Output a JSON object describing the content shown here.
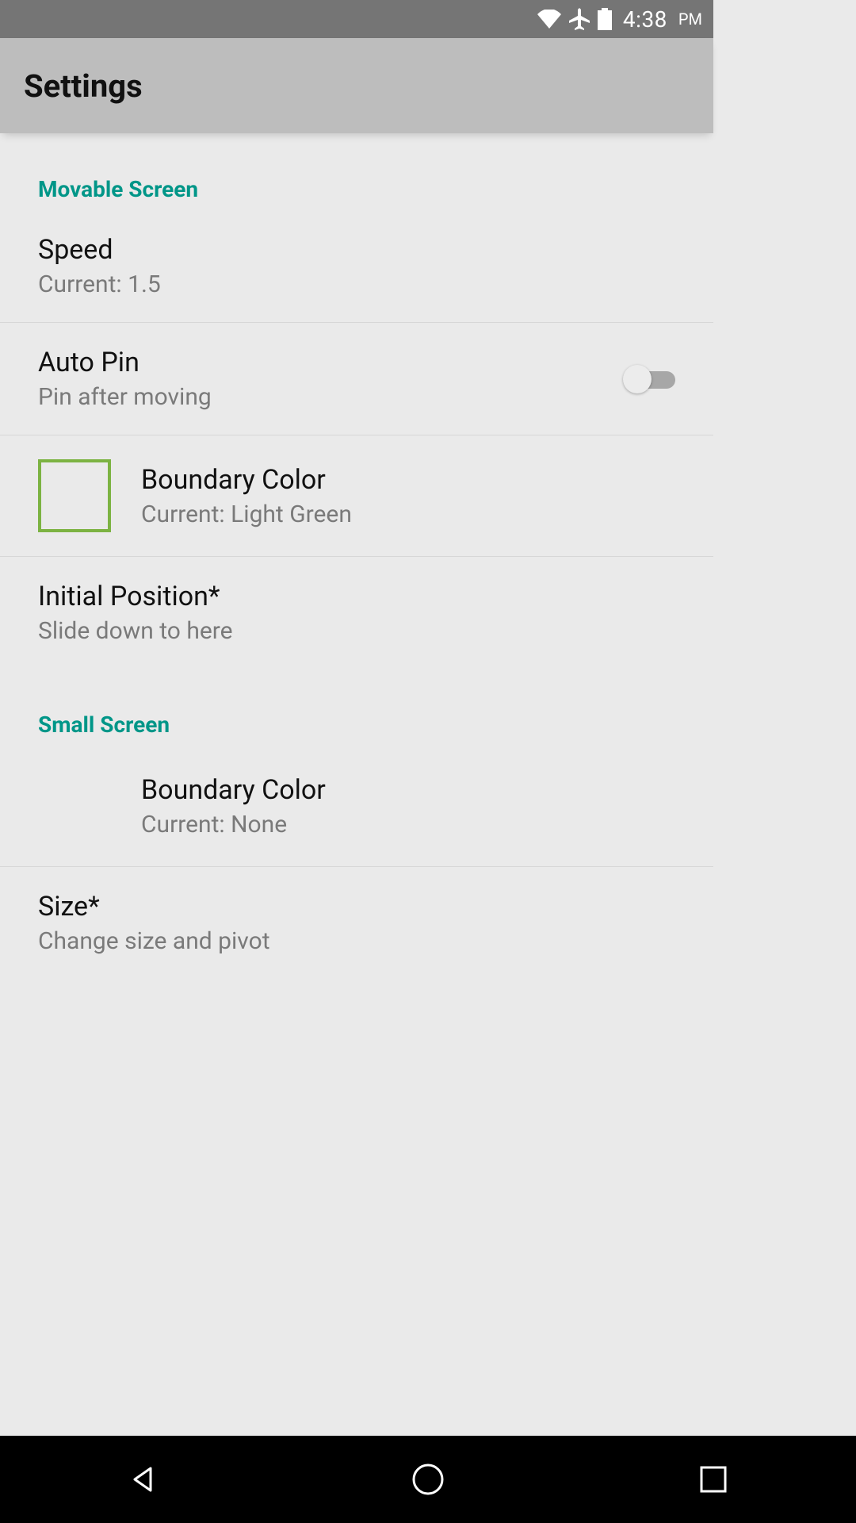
{
  "status": {
    "time": "4:38",
    "ampm": "PM",
    "icons": {
      "wifi": "wifi-icon",
      "airplane": "airplane-icon",
      "battery": "battery-icon"
    }
  },
  "app_bar": {
    "title": "Settings"
  },
  "sections": {
    "movable": {
      "header": "Movable Screen",
      "speed": {
        "title": "Speed",
        "sub": "Current: 1.5"
      },
      "auto_pin": {
        "title": "Auto Pin",
        "sub": "Pin after moving",
        "enabled": false
      },
      "boundary_color": {
        "title": "Boundary Color",
        "sub": "Current: Light Green",
        "swatch_border": "#7cb342"
      },
      "initial_position": {
        "title": "Initial Position*",
        "sub": "Slide down to here"
      }
    },
    "small": {
      "header": "Small Screen",
      "boundary_color": {
        "title": "Boundary Color",
        "sub": "Current: None"
      },
      "size": {
        "title": "Size*",
        "sub": "Change size and pivot"
      }
    }
  },
  "colors": {
    "accent": "#009688"
  }
}
